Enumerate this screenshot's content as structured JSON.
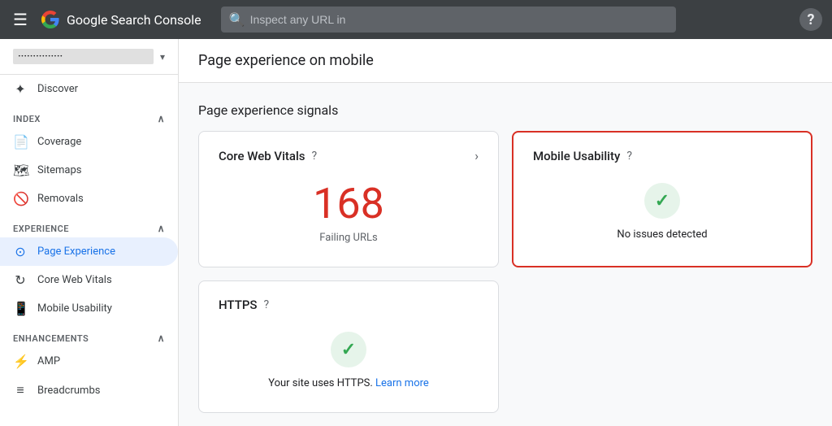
{
  "topbar": {
    "app_name": "Google Search Console",
    "search_placeholder": "Inspect any URL in",
    "help_label": "?"
  },
  "sidebar": {
    "property_name": "···············",
    "discover_label": "Discover",
    "index_section": "Index",
    "index_toggle": "∧",
    "index_items": [
      {
        "id": "coverage",
        "label": "Coverage"
      },
      {
        "id": "sitemaps",
        "label": "Sitemaps"
      },
      {
        "id": "removals",
        "label": "Removals"
      }
    ],
    "experience_section": "Experience",
    "experience_toggle": "∧",
    "experience_items": [
      {
        "id": "page-experience",
        "label": "Page Experience",
        "active": true
      },
      {
        "id": "core-web-vitals",
        "label": "Core Web Vitals"
      },
      {
        "id": "mobile-usability",
        "label": "Mobile Usability"
      }
    ],
    "enhancements_section": "Enhancements",
    "enhancements_toggle": "∧",
    "enhancements_items": [
      {
        "id": "amp",
        "label": "AMP"
      },
      {
        "id": "breadcrumbs",
        "label": "Breadcrumbs"
      }
    ]
  },
  "content": {
    "page_title": "Page experience on mobile",
    "signals_title": "Page experience signals",
    "cards": [
      {
        "id": "core-web-vitals",
        "title": "Core Web Vitals",
        "has_arrow": true,
        "highlighted": false,
        "type": "number",
        "number": "168",
        "number_label": "Failing URLs"
      },
      {
        "id": "mobile-usability",
        "title": "Mobile Usability",
        "has_arrow": false,
        "highlighted": true,
        "type": "check",
        "check_label": "No issues detected"
      },
      {
        "id": "https",
        "title": "HTTPS",
        "has_arrow": false,
        "highlighted": false,
        "type": "check",
        "check_label_prefix": "Your site uses HTTPS.",
        "check_label_link": "Learn more",
        "check_label_suffix": ""
      }
    ]
  }
}
